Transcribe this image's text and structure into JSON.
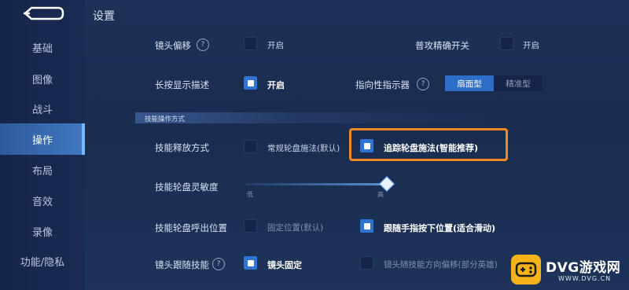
{
  "page_title": "设置",
  "sidebar": {
    "items": [
      {
        "label": "基础"
      },
      {
        "label": "图像"
      },
      {
        "label": "战斗"
      },
      {
        "label": "操作"
      },
      {
        "label": "布局"
      },
      {
        "label": "音效"
      },
      {
        "label": "录像"
      },
      {
        "label": "功能/隐私"
      }
    ],
    "active_index": 3
  },
  "settings": {
    "camera_offset": {
      "label": "镜头偏移",
      "help": "?",
      "option": "开启",
      "checked": false
    },
    "basic_attack_precise": {
      "label": "普攻精确开关",
      "option": "开启",
      "checked": false
    },
    "long_press_desc": {
      "label": "长按显示描述",
      "option": "开启",
      "checked": true
    },
    "directional_indicator": {
      "label": "指向性指示器",
      "help": "?",
      "options": [
        "扇面型",
        "精准型"
      ],
      "selected": "扇面型"
    },
    "section_skill_operation": "技能操作方式",
    "skill_cast_mode": {
      "label": "技能释放方式",
      "option_normal": "常规轮盘施法(默认)",
      "option_tracking": "追踪轮盘施法(智能推荐)",
      "selected": "tracking"
    },
    "skill_wheel_sensitivity": {
      "label": "技能轮盘灵敏度",
      "min_label": "低",
      "max_label": "高",
      "value": 1.0
    },
    "skill_wheel_position": {
      "label": "技能轮盘呼出位置",
      "option_fixed": "固定位置(默认)",
      "option_follow": "跟随手指按下位置(适合滑动)",
      "selected": "follow"
    },
    "camera_follow_skill": {
      "label": "镜头跟随技能",
      "help": "?",
      "option_fixed": "镜头固定",
      "option_follow": "镜头随技能方向偏移(部分英雄)",
      "selected": "fixed"
    }
  },
  "watermark": {
    "title": "DVG游戏网",
    "url": "WWW.DVG.CN"
  },
  "colors": {
    "accent": "#2f74d0",
    "highlight": "#f08a26",
    "watermark": "#f4b21b"
  }
}
